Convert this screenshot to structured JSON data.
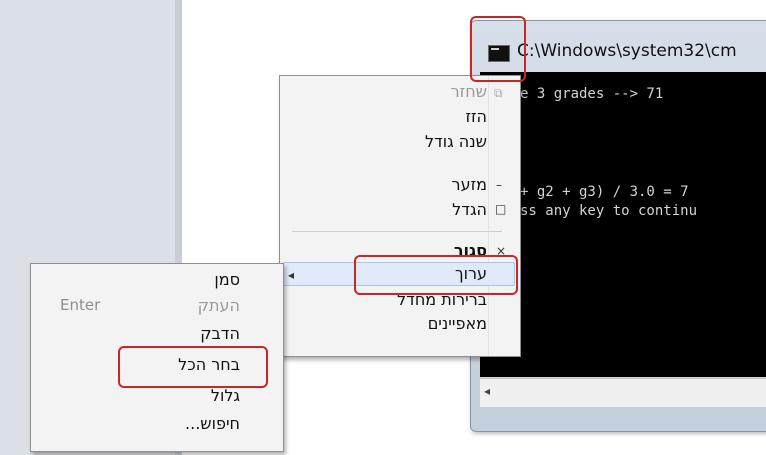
{
  "console": {
    "title": "C:\\Windows\\system32\\cm",
    "lines": [
      "e 3 grades --> 71",
      "+ g2 + g3) / 3.0 = 7",
      "ss any key to continu"
    ]
  },
  "system_menu": {
    "items": [
      {
        "label": "שחזר",
        "glyph": "⧉",
        "state": "disabled"
      },
      {
        "label": "הזז",
        "glyph": "",
        "state": "normal"
      },
      {
        "label": "שנה גודל",
        "glyph": "",
        "state": "normal"
      },
      {
        "label": "מזער",
        "glyph": "–",
        "state": "normal"
      },
      {
        "label": "הגדל",
        "glyph": "□",
        "state": "normal"
      },
      {
        "label": "סגור",
        "glyph": "×",
        "state": "bold"
      },
      {
        "label": "ערוך",
        "glyph": "◂",
        "state": "highlighted"
      },
      {
        "label": "ברירות מחדל",
        "glyph": "",
        "state": "normal"
      },
      {
        "label": "מאפיינים",
        "glyph": "",
        "state": "normal"
      }
    ]
  },
  "edit_menu": {
    "items": [
      {
        "label": "סמן",
        "shortcut": "",
        "state": "normal"
      },
      {
        "label": "העתק",
        "shortcut": "Enter",
        "state": "disabled"
      },
      {
        "label": "הדבק",
        "shortcut": "",
        "state": "normal"
      },
      {
        "label": "בחר הכל",
        "shortcut": "",
        "state": "normal"
      },
      {
        "label": "גלול",
        "shortcut": "",
        "state": "normal"
      },
      {
        "label": "חיפוש...",
        "shortcut": "",
        "state": "normal"
      }
    ]
  },
  "colors": {
    "annotation": "#c62828",
    "menu_bg": "#f3f3f3",
    "highlight": "#dfe9f7",
    "console_bg": "#000000"
  }
}
